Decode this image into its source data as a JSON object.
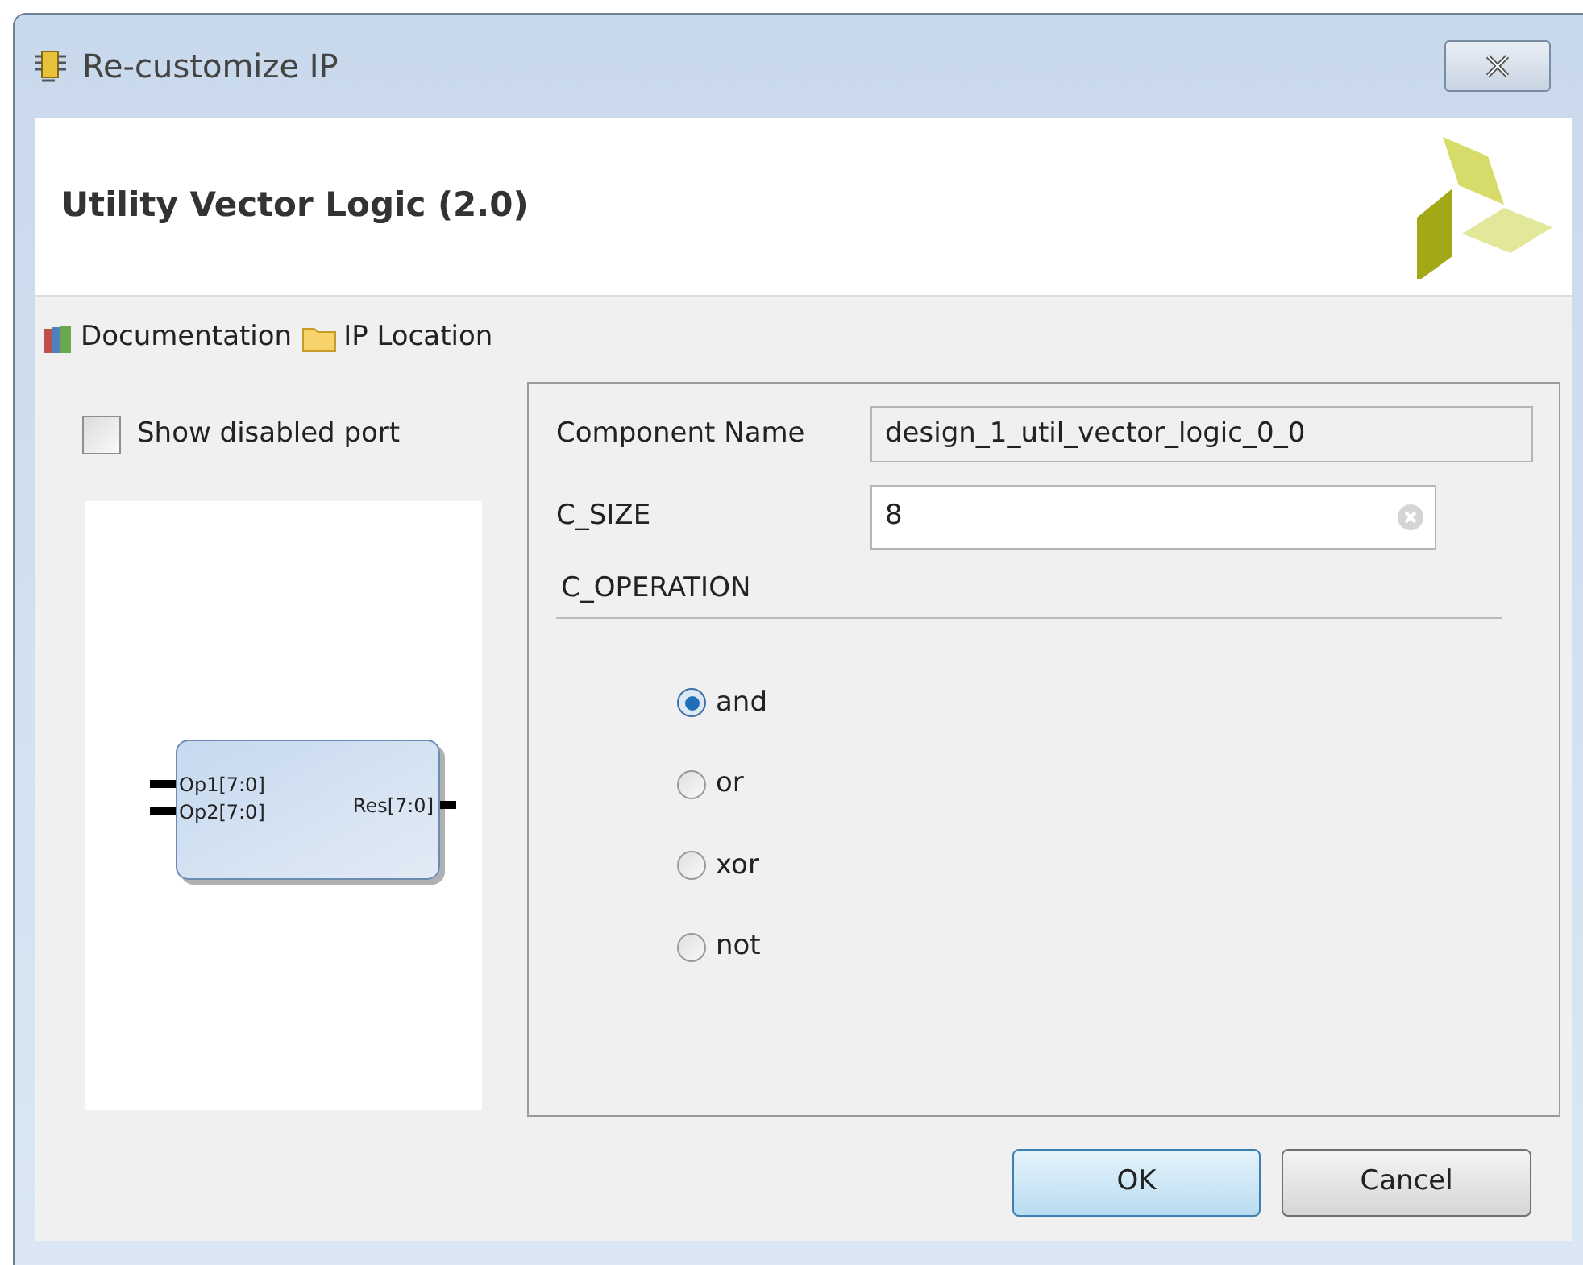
{
  "window": {
    "title": "Re-customize IP"
  },
  "header": {
    "title": "Utility Vector Logic (2.0)"
  },
  "toolbar": [
    {
      "kind": "docs",
      "label": "Documentation"
    },
    {
      "kind": "folder",
      "label": "IP Location"
    }
  ],
  "left_panel": {
    "show_disabled_ports": {
      "label": "Show disabled port",
      "checked": false
    },
    "block": {
      "inputs": [
        "Op1[7:0]",
        "Op2[7:0]"
      ],
      "outputs": [
        "Res[7:0]"
      ]
    }
  },
  "form": {
    "component_name": {
      "label": "Component Name",
      "value": "design_1_util_vector_logic_0_0"
    },
    "c_size": {
      "label": "C_SIZE",
      "value": "8"
    },
    "c_operation": {
      "label": "C_OPERATION",
      "options": [
        {
          "label": "and",
          "selected": true
        },
        {
          "label": "or",
          "selected": false
        },
        {
          "label": "xor",
          "selected": false
        },
        {
          "label": "not",
          "selected": false
        }
      ]
    }
  },
  "buttons": [
    {
      "label": "OK",
      "default": true
    },
    {
      "label": "Cancel",
      "default": false
    }
  ]
}
